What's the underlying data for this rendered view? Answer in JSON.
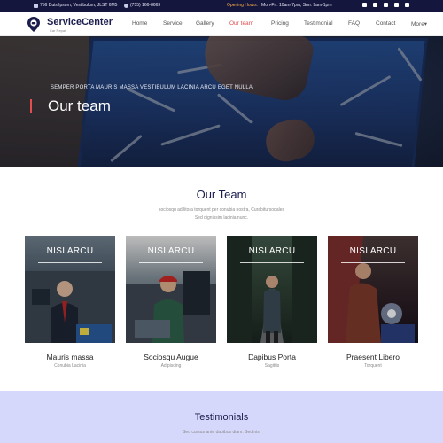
{
  "topbar": {
    "address": "756 Duis Ipsum, Vestibulum, JLST 6M5",
    "phone": "(755) 166-8669",
    "hours_label": "Opening Hours:",
    "hours_value": "Mon-Fri: 10am-7pm, Sun: 9am-1pm",
    "social": [
      "facebook-icon",
      "twitter-icon",
      "instagram-icon",
      "linkedin-icon",
      "dribbble-icon"
    ]
  },
  "brand": {
    "name": "ServiceCenter",
    "tagline": "Car Repair"
  },
  "nav": {
    "items": [
      "Home",
      "Service",
      "Gallery",
      "Our team",
      "Pricing",
      "Testimonial",
      "FAQ",
      "Contact",
      "More▾"
    ],
    "active": "Our team"
  },
  "hero": {
    "kicker": "SEMPER PORTA MAURIS MASSA VESTIBULUM LACINIA ARCU EGET NULLA",
    "title": "Our team"
  },
  "team_section": {
    "title": "Our Team",
    "subtitle_line1": "sociosqu ad litora torquent per conubia nostra, Curabitursodales",
    "subtitle_line2": "Sed dignissim lacinia nunc."
  },
  "members": [
    {
      "overlay": "NISI ARCU",
      "name": "Mauris massa",
      "role": "Conubia Lacinia"
    },
    {
      "overlay": "NISI ARCU",
      "name": "Sociosqu Augue",
      "role": "Adipiscing"
    },
    {
      "overlay": "NISI ARCU",
      "name": "Dapibus Porta",
      "role": "Sagittis"
    },
    {
      "overlay": "NISI ARCU",
      "name": "Praesent Libero",
      "role": "Torquent"
    }
  ],
  "testimonials": {
    "title": "Testimonials",
    "subtitle": "Sed cursus ante dapibus diam. Sed nisi"
  },
  "colors": {
    "topbar_bg": "#15163e",
    "brand_navy": "#1b1d4d",
    "accent_red": "#e24e4e",
    "hours_orange": "#ffb24a",
    "testimonials_bg": "#d6d8fb"
  }
}
